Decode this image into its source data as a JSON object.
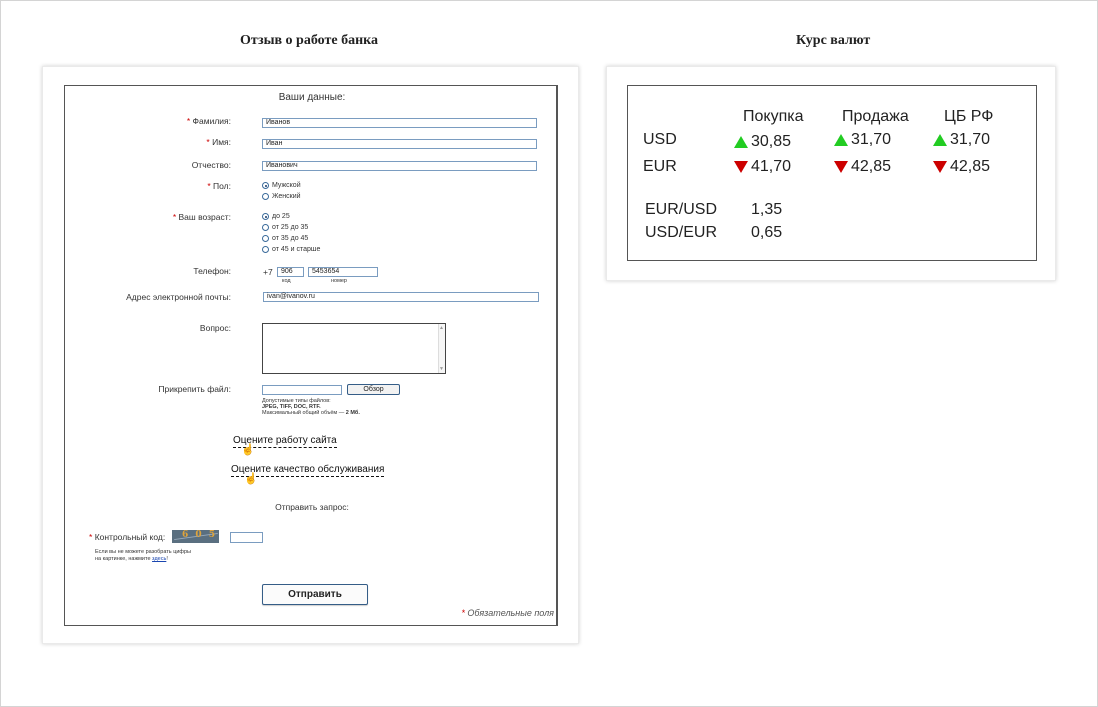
{
  "left_title": "Отзыв о работе банка",
  "right_title": "Курс валют",
  "form": {
    "section_title": "Ваши данные:",
    "required_mark": "*",
    "surname": {
      "label": "Фамилия:",
      "value": "Иванов"
    },
    "name": {
      "label": "Имя:",
      "value": "Иван"
    },
    "patronymic": {
      "label": "Отчество:",
      "value": "Иванович"
    },
    "gender": {
      "label": "Пол:",
      "options": [
        "Мужской",
        "Женский"
      ],
      "selected": "Мужской"
    },
    "age": {
      "label": "Ваш возраст:",
      "options": [
        "до 25",
        "от 25 до 35",
        "от 35 до 45",
        "от 45 и старше"
      ],
      "selected": "до 25"
    },
    "phone": {
      "label": "Телефон:",
      "prefix": "+7",
      "code_value": "906",
      "number_value": "5453654",
      "code_caption": "код",
      "number_caption": "номер"
    },
    "email": {
      "label": "Адрес электронной почты:",
      "value": "ivan@ivanov.ru"
    },
    "question": {
      "label": "Вопрос:"
    },
    "attach": {
      "label": "Прикрепить файл:",
      "button": "Обзор",
      "note_line1": "Допустимые типы файлов:",
      "note_line2": "JPEG, TIFF, DOC, RTF.",
      "note_line3_text": "Максимальный общий объём — ",
      "note_line3_bold": "2 Мб."
    },
    "rate_site": "Оцените работу сайта",
    "rate_service": "Оцените качество обслуживания",
    "send_request": "Отправить запрос:",
    "captcha": {
      "label": "Контрольный код:",
      "image_text": "6 0 5",
      "help_line1": "Если вы не можете разобрать цифры",
      "help_line2_text": "на картинке, нажмите ",
      "help_link": "здесь",
      "help_end": "!"
    },
    "submit": "Отправить",
    "required_note": "Обязательные поля"
  },
  "rates": {
    "headers": [
      "Покупка",
      "Продажа",
      "ЦБ РФ"
    ],
    "rows": [
      {
        "currency": "USD",
        "values": [
          "30,85",
          "31,70",
          "31,70"
        ],
        "directions": [
          "up",
          "up",
          "up"
        ]
      },
      {
        "currency": "EUR",
        "values": [
          "41,70",
          "42,85",
          "42,85"
        ],
        "directions": [
          "down",
          "down",
          "down"
        ]
      }
    ],
    "cross": [
      {
        "pair": "EUR/USD",
        "value": "1,35"
      },
      {
        "pair": "USD/EUR",
        "value": "0,65"
      }
    ],
    "up_color": "#22cc22",
    "down_color": "#cc0000"
  }
}
